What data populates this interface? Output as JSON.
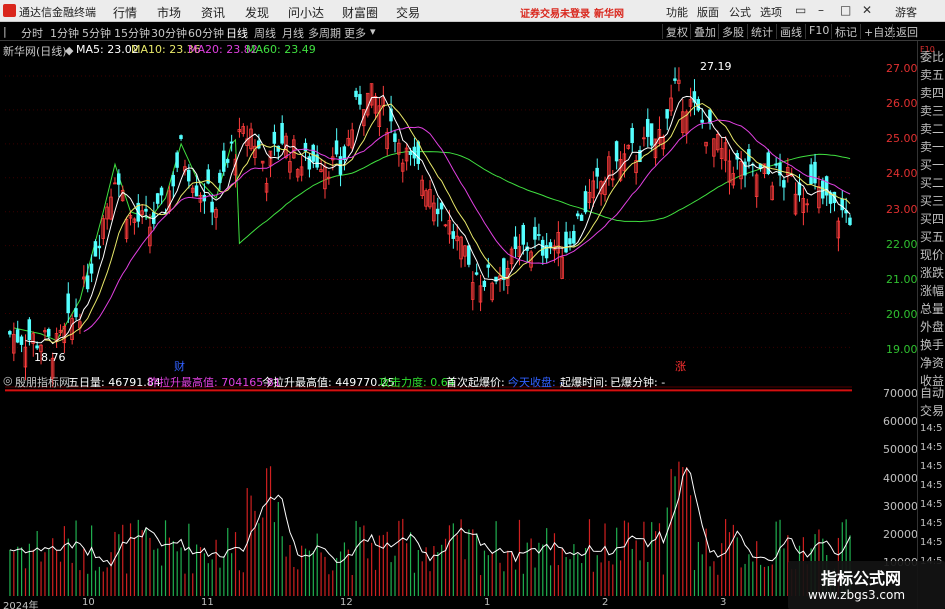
{
  "app": {
    "title": "通达信金融终端",
    "warning": "证券交易未登录",
    "stock_name": "新华网",
    "guest": "游客"
  },
  "menu": [
    "行情",
    "市场",
    "资讯",
    "发现",
    "问小达",
    "财富圈",
    "交易"
  ],
  "menu_right": [
    "功能",
    "版面",
    "公式",
    "选项"
  ],
  "periods": [
    "分时",
    "1分钟",
    "5分钟",
    "15分钟",
    "30分钟",
    "60分钟",
    "日线",
    "周线",
    "月线",
    "多周期",
    "更多"
  ],
  "active_period": "日线",
  "toolbar_right": [
    "复权",
    "叠加",
    "多股",
    "统计",
    "画线",
    "F10",
    "标记",
    "+自选",
    "返回"
  ],
  "ma_legend": {
    "name": "新华网(日线)",
    "items": [
      {
        "label": "MA5: 23.02",
        "color": "#ffffff"
      },
      {
        "label": "MA10: 23.36",
        "color": "#e8e86a"
      },
      {
        "label": "MA20: 23.82",
        "color": "#e040e0"
      },
      {
        "label": "MA60: 23.49",
        "color": "#40e040"
      }
    ]
  },
  "price_axis": [
    "27.00",
    "26.00",
    "25.00",
    "24.00",
    "23.00",
    "22.00",
    "21.00",
    "20.00",
    "19.00"
  ],
  "price_range": [
    18.6,
    27.5
  ],
  "annotations": {
    "high": "27.19",
    "low": "18.76",
    "marker_cai": "财",
    "marker_zhang": "涨"
  },
  "indicator": {
    "name": "殷朋指标网",
    "fields": [
      {
        "label": "五日量: 46791.84",
        "color": "#ffffff"
      },
      {
        "label": "昨拉升最高值: 704165.81",
        "color": "#e040e0"
      },
      {
        "label": "今拉升最高值: 449770.25",
        "color": "#ffffff"
      },
      {
        "label": "攻击力度: 0.64",
        "color": "#30e030"
      },
      {
        "label": "首次起爆价: -",
        "color": "#ffffff"
      },
      {
        "label": "今天收盘: -",
        "color": "#3060ff"
      },
      {
        "label": "起爆时间: -",
        "color": "#ffffff"
      },
      {
        "label": "已爆分钟: -",
        "color": "#ffffff"
      }
    ]
  },
  "volume_axis": [
    "70000",
    "60000",
    "50000",
    "40000",
    "30000",
    "20000",
    "10000"
  ],
  "volume_max": 75000,
  "date_axis": [
    "2024年",
    "10",
    "11",
    "12",
    "1",
    "2",
    "3"
  ],
  "sidebar": {
    "items": [
      "委比",
      "卖五",
      "卖四",
      "卖三",
      "卖二",
      "卖一",
      "买一",
      "买二",
      "买三",
      "买四",
      "买五",
      "现价",
      "涨跌",
      "涨幅",
      "总量",
      "外盘",
      "换手",
      "净资",
      "收益"
    ],
    "lower": [
      "自动",
      "交易"
    ],
    "times": [
      "14:5",
      "14:5",
      "14:5",
      "14:5",
      "14:5",
      "14:5",
      "14:5",
      "14:5"
    ],
    "top_right": "F10"
  },
  "watermark": {
    "line1": "指标公式网",
    "line2": "www.zbgs3.com"
  },
  "colors": {
    "up": "#ff3c3c",
    "down": "#54ffff",
    "ma5": "#ffffff",
    "ma10": "#e8e86a",
    "ma20": "#e040e0",
    "ma60": "#40e040",
    "vol_line": "#ffffff"
  }
}
